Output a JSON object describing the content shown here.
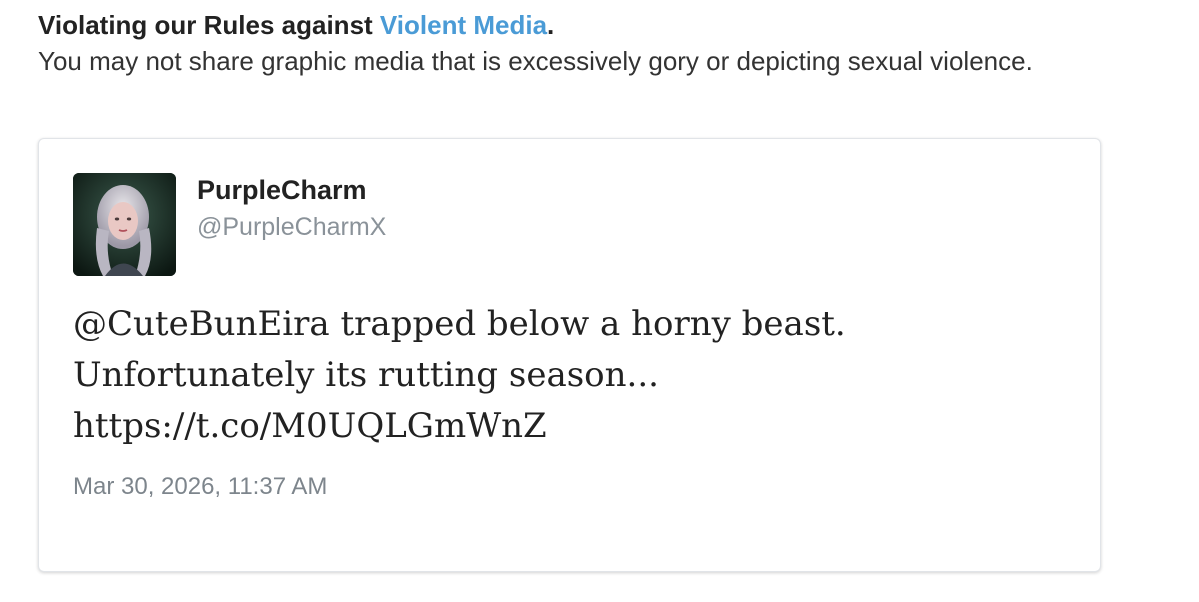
{
  "notice": {
    "title_prefix": "Violating our Rules against ",
    "rule_name": "Violent Media",
    "title_suffix": ".",
    "description": "You may not share graphic media that is excessively gory or depicting sexual violence.",
    "link_color": "#4a9bd6"
  },
  "tweet": {
    "avatar_icon": "profile-avatar",
    "display_name": "PurpleCharm",
    "handle": "@PurpleCharmX",
    "text_lines": [
      "@CuteBunEira trapped below a horny beast.",
      "Unfortunately its rutting season...",
      "https://t.co/M0UQLGmWnZ"
    ],
    "timestamp": "Mar 30, 2026, 11:37 AM"
  }
}
